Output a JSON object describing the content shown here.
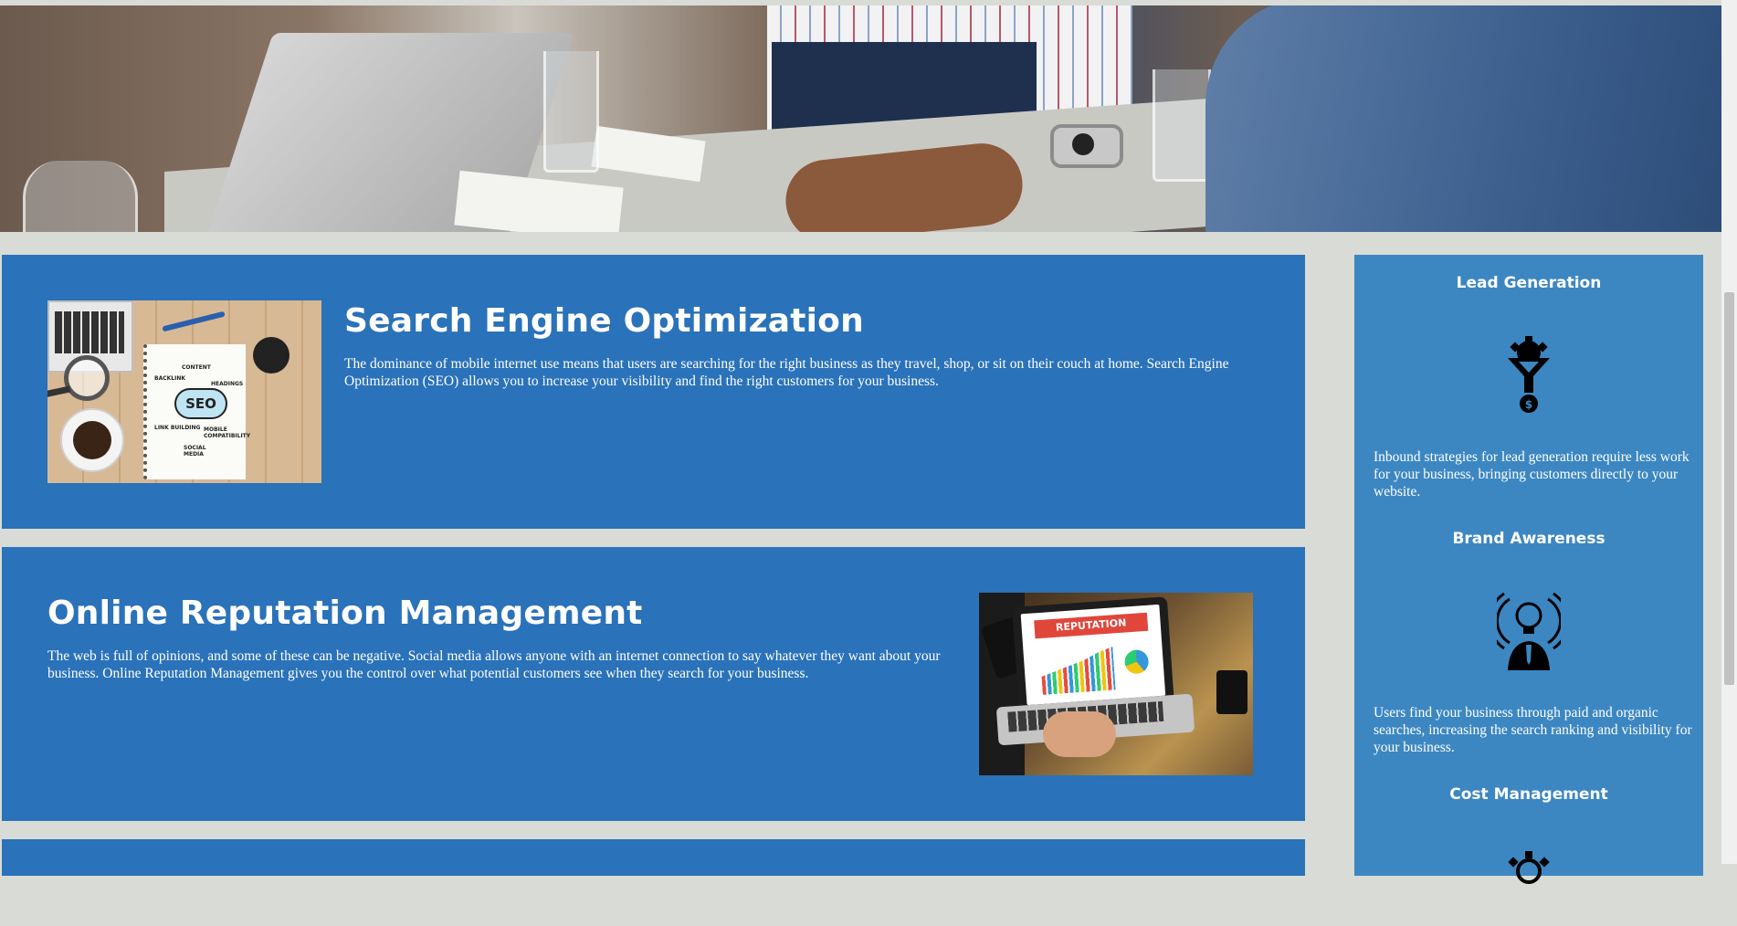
{
  "hero": {
    "image_name": "meeting-hero-photo"
  },
  "services": [
    {
      "title": "Search Engine Optimization",
      "body": "The dominance of mobile internet use means that users are searching for the right business as they travel, shop, or sit on their couch at home. Search Engine Optimization (SEO) allows you to increase your visibility and find the right customers for your business.",
      "image": {
        "icon": "seo-illustration",
        "cloud_text": "SEO",
        "words": [
          "CONTENT",
          "BACKLINK",
          "HEADINGS",
          "LINK BUILDING",
          "MOBILE COMPATIBILITY",
          "SOCIAL MEDIA"
        ]
      }
    },
    {
      "title": "Online Reputation Management",
      "body": "The web is full of opinions, and some of these can be negative. Social media allows anyone with an internet connection to say whatever they want about your business. Online Reputation Management gives you the control over what potential customers see when they search for your business.",
      "image": {
        "icon": "reputation-laptop-illustration",
        "banner_text": "REPUTATION"
      }
    }
  ],
  "benefits": [
    {
      "title": "Lead Generation",
      "icon": "lead-funnel-icon",
      "body": "Inbound strategies for lead generation require less work for your business, bringing customers directly to your website."
    },
    {
      "title": "Brand Awareness",
      "icon": "brand-lightbulb-icon",
      "body": "Users find your business through paid and organic searches, increasing the search ranking and visibility for your business."
    },
    {
      "title": "Cost Management",
      "icon": "cost-gear-icon",
      "body": ""
    }
  ],
  "colors": {
    "page_background": "#d9dcd6",
    "service_card": "#2a72b9",
    "sidebar": "#3c87c2",
    "text": "#ffffff"
  }
}
